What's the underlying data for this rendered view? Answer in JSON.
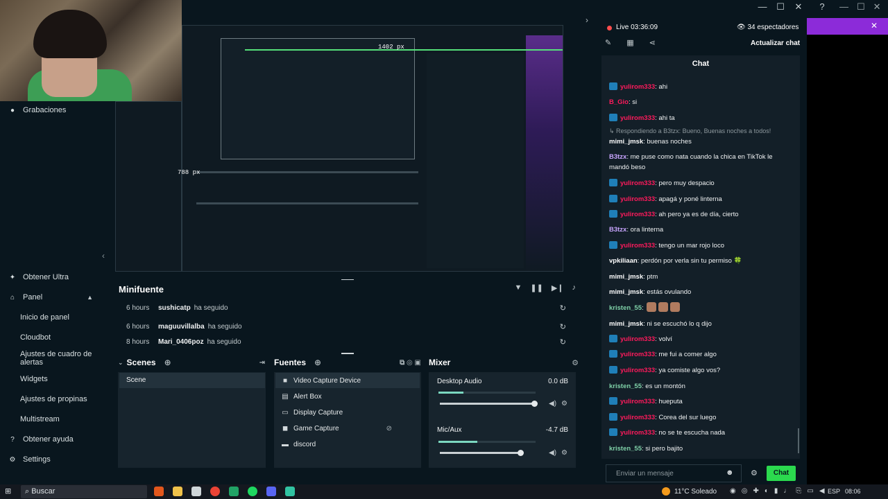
{
  "window": {
    "minimize": "—",
    "maximize": "☐",
    "close": "✕",
    "help": "?"
  },
  "sidebar": {
    "top_item": "Grabaciones",
    "items": [
      {
        "label": "Obtener Ultra",
        "icon": "ultra-icon"
      },
      {
        "label": "Panel",
        "icon": "panel-icon",
        "expanded": true
      },
      {
        "label": "Inicio de panel",
        "sub": true
      },
      {
        "label": "Cloudbot",
        "sub": true
      },
      {
        "label": "Ajustes de cuadro de alertas",
        "sub": true
      },
      {
        "label": "Widgets",
        "sub": true
      },
      {
        "label": "Ajustes de propinas",
        "sub": true
      },
      {
        "label": "Multistream",
        "sub": true
      },
      {
        "label": "Obtener ayuda",
        "icon": "help-icon"
      },
      {
        "label": "Settings",
        "icon": "gear-icon"
      }
    ]
  },
  "preview": {
    "width_label": "1402 px",
    "height_label": "788 px"
  },
  "minifuente": {
    "title": "Minifuente",
    "events": [
      {
        "time": "6 hours",
        "user": "sushicatp",
        "action": "ha seguido"
      },
      {
        "time": "6 hours",
        "user": "maguuvillalba",
        "action": "ha seguido"
      },
      {
        "time": "8 hours",
        "user": "Mari_0406poz",
        "action": "ha seguido"
      }
    ]
  },
  "scenes": {
    "title": "Scenes",
    "items": [
      "Scene"
    ]
  },
  "sources": {
    "title": "Fuentes",
    "items": [
      {
        "label": "Video Capture Device",
        "icon": "camera-icon",
        "selected": true
      },
      {
        "label": "Alert Box",
        "icon": "bell-icon"
      },
      {
        "label": "Display Capture",
        "icon": "monitor-icon"
      },
      {
        "label": "Game Capture",
        "icon": "gamepad-icon",
        "hidden": true
      },
      {
        "label": "discord",
        "icon": "window-icon"
      }
    ]
  },
  "mixer": {
    "title": "Mixer",
    "channels": [
      {
        "name": "Desktop Audio",
        "db": "0.0 dB",
        "level": 0.26,
        "volume": 1.0
      },
      {
        "name": "Mic/Aux",
        "db": "-4.7 dB",
        "level": 0.4,
        "volume": 0.85
      }
    ]
  },
  "stream": {
    "live_label": "Live 03:36:09",
    "viewers": "34 espectadores",
    "refresh_chat": "Actualizar chat"
  },
  "chat": {
    "title": "Chat",
    "reply_note": "↳ Respondiendo a B3tzx: Bueno, Buenas noches a todos!",
    "messages": [
      {
        "user": "yulirom333",
        "text": ": ahi",
        "color": "#ff1a5c",
        "badge": true
      },
      {
        "user": "B_Gio",
        "text": ": si",
        "color": "#ff1a5c",
        "badge": false
      },
      {
        "user": "yulirom333",
        "text": ": ahi ta",
        "color": "#ff1a5c",
        "badge": true
      },
      {
        "user": "mimi_jmsk",
        "text": ": buenas noches",
        "color": "#ffffff",
        "badge": false
      },
      {
        "user": "B3tzx",
        "text": ": me puse como nata cuando la chica en TikTok le mandó beso",
        "color": "#c9a5ff",
        "badge": false
      },
      {
        "user": "yulirom333",
        "text": ": pero muy despacio",
        "color": "#ff1a5c",
        "badge": true
      },
      {
        "user": "yulirom333",
        "text": ": apagá y poné linterna",
        "color": "#ff1a5c",
        "badge": true
      },
      {
        "user": "yulirom333",
        "text": ": ah pero ya es de día, cierto",
        "color": "#ff1a5c",
        "badge": true
      },
      {
        "user": "B3tzx",
        "text": ": ora linterna",
        "color": "#c9a5ff",
        "badge": false
      },
      {
        "user": "yulirom333",
        "text": ": tengo un mar rojo loco",
        "color": "#ff1a5c",
        "badge": true
      },
      {
        "user": "vpkiliaan",
        "text": ": perdón por verla sin tu permiso 🍀",
        "color": "#ffffff",
        "badge": false
      },
      {
        "user": "mimi_jmsk",
        "text": ": ptm",
        "color": "#ffffff",
        "badge": false
      },
      {
        "user": "mimi_jmsk",
        "text": ": estás ovulando",
        "color": "#ffffff",
        "badge": false
      },
      {
        "user": "kristen_55",
        "text": ":",
        "color": "#7fd1a8",
        "badge": false,
        "emotes": 3
      },
      {
        "user": "mimi_jmsk",
        "text": ": ni se escuchó lo q dijo",
        "color": "#ffffff",
        "badge": false
      },
      {
        "user": "yulirom333",
        "text": ": volví",
        "color": "#ff1a5c",
        "badge": true
      },
      {
        "user": "yulirom333",
        "text": ": me fui a comer algo",
        "color": "#ff1a5c",
        "badge": true
      },
      {
        "user": "yulirom333",
        "text": ": ya comiste algo vos?",
        "color": "#ff1a5c",
        "badge": true
      },
      {
        "user": "kristen_55",
        "text": ": es un montón",
        "color": "#7fd1a8",
        "badge": false
      },
      {
        "user": "yulirom333",
        "text": ": hueputa",
        "color": "#ff1a5c",
        "badge": true
      },
      {
        "user": "yulirom333",
        "text": ": Corea del sur luego",
        "color": "#ff1a5c",
        "badge": true
      },
      {
        "user": "yulirom333",
        "text": ": no se te escucha nada",
        "color": "#ff1a5c",
        "badge": true
      },
      {
        "user": "kristen_55",
        "text": ": si pero bajito",
        "color": "#7fd1a8",
        "badge": false
      }
    ],
    "input_placeholder": "Enviar un mensaje",
    "send_label": "Chat"
  },
  "taskbar": {
    "search_label": "Buscar",
    "weather": "11°C Soleado",
    "language": "ESP",
    "time": "08:06"
  },
  "colors": {
    "accent_green": "#2bd94e",
    "purple": "#8c2bd9",
    "background": "#09161e",
    "panel": "#17242d"
  }
}
